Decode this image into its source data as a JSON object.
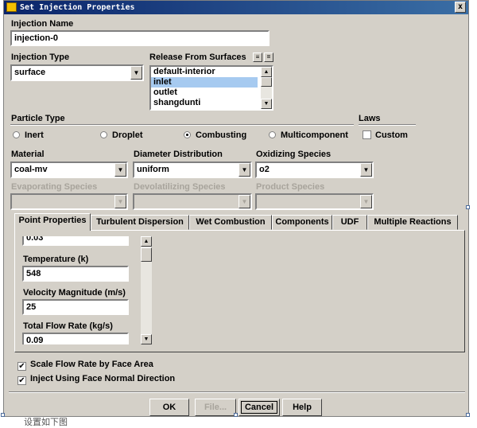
{
  "window": {
    "title": "Set Injection Properties",
    "close_glyph": "x"
  },
  "injection_name": {
    "label": "Injection Name",
    "value": "injection-0"
  },
  "injection_type": {
    "label": "Injection Type",
    "value": "surface"
  },
  "release_from_surfaces": {
    "label": "Release From Surfaces",
    "buttons": [
      "≡",
      "="
    ],
    "items": [
      "default-interior",
      "inlet",
      "outlet",
      "shangdunti"
    ],
    "selected": "inlet"
  },
  "particle_type": {
    "label": "Particle Type",
    "options": [
      "Inert",
      "Droplet",
      "Combusting",
      "Multicomponent"
    ],
    "selected": "Combusting"
  },
  "laws": {
    "label": "Laws",
    "custom_label": "Custom",
    "custom_checked": false
  },
  "material": {
    "label": "Material",
    "value": "coal-mv"
  },
  "diameter_distribution": {
    "label": "Diameter Distribution",
    "value": "uniform"
  },
  "oxidizing_species": {
    "label": "Oxidizing Species",
    "value": "o2"
  },
  "evaporating_species": {
    "label": "Evaporating Species",
    "value": ""
  },
  "devolatilizing_species": {
    "label": "Devolatilizing Species",
    "value": ""
  },
  "product_species": {
    "label": "Product Species",
    "value": ""
  },
  "tabs": [
    {
      "label": "Point Properties",
      "active": true
    },
    {
      "label": "Turbulent Dispersion",
      "active": false
    },
    {
      "label": "Wet Combustion",
      "active": false
    },
    {
      "label": "Components",
      "active": false
    },
    {
      "label": "UDF",
      "active": false
    },
    {
      "label": "Multiple Reactions",
      "active": false
    }
  ],
  "point_properties": {
    "partial_value": "0.03",
    "temperature": {
      "label": "Temperature (k)",
      "value": "548"
    },
    "velocity_magnitude": {
      "label": "Velocity Magnitude (m/s)",
      "value": "25"
    },
    "total_flow_rate": {
      "label": "Total Flow Rate (kg/s)",
      "value": "0.09"
    }
  },
  "scale_flow_rate": {
    "label": "Scale Flow Rate by Face Area",
    "checked": true
  },
  "inject_normal": {
    "label": "Inject Using Face Normal Direction",
    "checked": true
  },
  "buttons": {
    "ok": "OK",
    "file": "File...",
    "cancel": "Cancel",
    "help": "Help"
  },
  "glyphs": {
    "check": "✔",
    "arrow_down": "▼",
    "arrow_up": "▲"
  },
  "caption": "设置如下图"
}
